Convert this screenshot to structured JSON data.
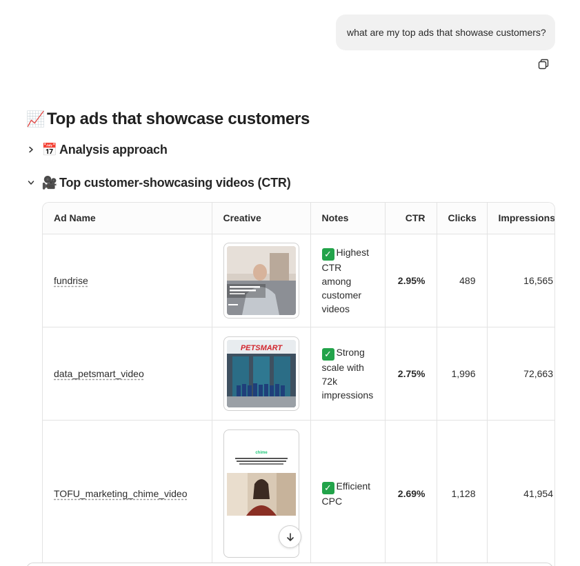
{
  "user_message": "what are my top ads that showase customers?",
  "response": {
    "title_emoji": "📈",
    "title": "Top ads that showcase customers",
    "sections": [
      {
        "emoji": "📅",
        "label": "Analysis approach",
        "expanded": false
      },
      {
        "emoji": "🎥",
        "label": "Top customer-showcasing videos (CTR)",
        "expanded": true
      }
    ]
  },
  "table": {
    "headers": [
      "Ad Name",
      "Creative",
      "Notes",
      "CTR",
      "Clicks",
      "Impressions"
    ],
    "rows": [
      {
        "ad_name": "fundrise",
        "creative_icon": "video-thumbnail-man-in-office",
        "note": "Highest CTR among customer videos",
        "ctr": "2.95%",
        "clicks": "489",
        "impressions": "16,565"
      },
      {
        "ad_name": "data_petsmart_video",
        "creative_icon": "video-thumbnail-petsmart-storefront",
        "note": "Strong scale with 72k impressions",
        "ctr": "2.75%",
        "clicks": "1,996",
        "impressions": "72,663"
      },
      {
        "ad_name": "TOFU_marketing_chime_video",
        "creative_icon": "video-thumbnail-chime-woman",
        "note": "Efficient CPC",
        "ctr": "2.69%",
        "clicks": "1,128",
        "impressions": "41,954"
      }
    ]
  },
  "thumb_text": {
    "petsmart_logo": "PETSMART",
    "chime_logo": "chime"
  },
  "colors": {
    "check_green": "#22a34a",
    "bubble_bg": "#f1f1f1",
    "border": "#e3e3e3"
  },
  "icons": {
    "copy": "copy-icon",
    "scroll": "arrow-down-icon",
    "chevron_collapsed": "chevron-right-icon",
    "chevron_expanded": "chevron-down-icon",
    "check": "check-mark-icon"
  }
}
